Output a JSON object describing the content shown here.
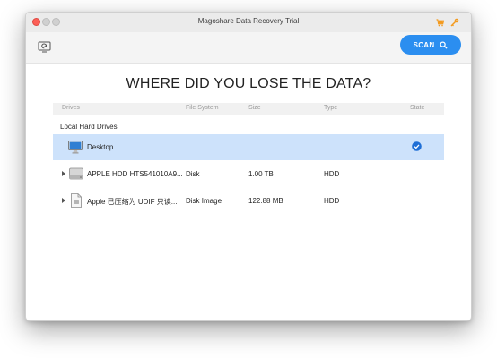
{
  "window": {
    "title": "Magoshare Data Recovery Trial"
  },
  "toolbar": {
    "scan_label": "SCAN"
  },
  "main": {
    "heading": "WHERE DID YOU LOSE THE DATA?",
    "columns": [
      "Drives",
      "File System",
      "Size",
      "Type",
      "State"
    ],
    "group_label": "Local Hard Drives",
    "rows": [
      {
        "name": "Desktop",
        "file_system": "",
        "size": "",
        "type": "",
        "selected": true
      },
      {
        "name": "APPLE HDD HTS541010A9...",
        "file_system": "Disk",
        "size": "1.00 TB",
        "type": "HDD",
        "selected": false
      },
      {
        "name": "Apple 已压缩为 UDIF 只读...",
        "file_system": "Disk Image",
        "size": "122.88 MB",
        "type": "HDD",
        "selected": false
      }
    ]
  },
  "colors": {
    "accent": "#2b8ef0",
    "selected_row": "#cde2fb",
    "close_button": "#fc5f57",
    "store_icon": "#f39a1e"
  },
  "icons": [
    "cart-icon",
    "key-icon",
    "restore-icon",
    "search-icon",
    "desktop-monitor-icon",
    "hard-drive-icon",
    "disk-image-icon",
    "checkmark-icon",
    "expand-arrow-icon"
  ]
}
